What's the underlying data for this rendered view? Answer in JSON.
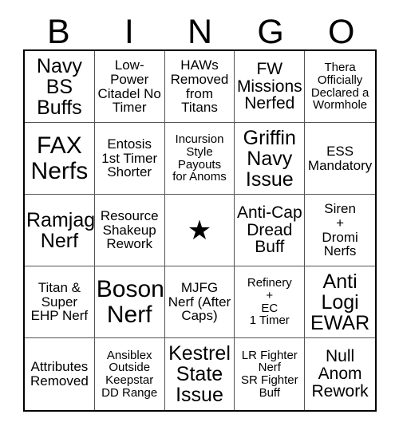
{
  "header": {
    "letters": [
      "B",
      "I",
      "N",
      "G",
      "O"
    ]
  },
  "grid": {
    "rows": 5,
    "columns": 5,
    "cells": [
      {
        "text": "Navy\nBS\nBuffs",
        "size": "lg",
        "free": false
      },
      {
        "text": "Low-\nPower\nCitadel No\nTimer",
        "size": "sm",
        "free": false
      },
      {
        "text": "HAWs\nRemoved\nfrom\nTitans",
        "size": "sm",
        "free": false
      },
      {
        "text": "FW\nMissions\nNerfed",
        "size": "md",
        "free": false
      },
      {
        "text": "Thera\nOfficially\nDeclared a\nWormhole",
        "size": "xs",
        "free": false
      },
      {
        "text": "FAX\nNerfs",
        "size": "xl",
        "free": false
      },
      {
        "text": "Entosis\n1st Timer\nShorter",
        "size": "sm",
        "free": false
      },
      {
        "text": "Incursion\nStyle\nPayouts\nfor Anoms",
        "size": "xs",
        "free": false
      },
      {
        "text": "Griffin\nNavy\nIssue",
        "size": "lg",
        "free": false
      },
      {
        "text": "ESS\nMandatory",
        "size": "sm",
        "free": false
      },
      {
        "text": "Ramjag\nNerf",
        "size": "lg",
        "free": false
      },
      {
        "text": "Resource\nShakeup\nRework",
        "size": "sm",
        "free": false
      },
      {
        "text": "★",
        "size": "free",
        "free": true
      },
      {
        "text": "Anti-Cap\nDread\nBuff",
        "size": "md",
        "free": false
      },
      {
        "text": "Siren\n+\nDromi\nNerfs",
        "size": "sm",
        "free": false
      },
      {
        "text": "Titan &\nSuper\nEHP Nerf",
        "size": "sm",
        "free": false
      },
      {
        "text": "Boson\nNerf",
        "size": "xl",
        "free": false
      },
      {
        "text": "MJFG\nNerf (After\nCaps)",
        "size": "sm",
        "free": false
      },
      {
        "text": "Refinery\n+\nEC\n1 Timer",
        "size": "xs",
        "free": false
      },
      {
        "text": "Anti\nLogi\nEWAR",
        "size": "lg",
        "free": false
      },
      {
        "text": "Attributes\nRemoved",
        "size": "sm",
        "free": false
      },
      {
        "text": "Ansiblex\nOutside\nKeepstar\nDD Range",
        "size": "xs",
        "free": false
      },
      {
        "text": "Kestrel\nState\nIssue",
        "size": "lg",
        "free": false
      },
      {
        "text": "LR Fighter\nNerf\nSR Fighter\nBuff",
        "size": "xs",
        "free": false
      },
      {
        "text": "Null\nAnom\nRework",
        "size": "md",
        "free": false
      }
    ]
  },
  "colors": {
    "background": "#ffffff",
    "text": "#000000",
    "outer_border": "#000000",
    "inner_border": "#555555"
  }
}
